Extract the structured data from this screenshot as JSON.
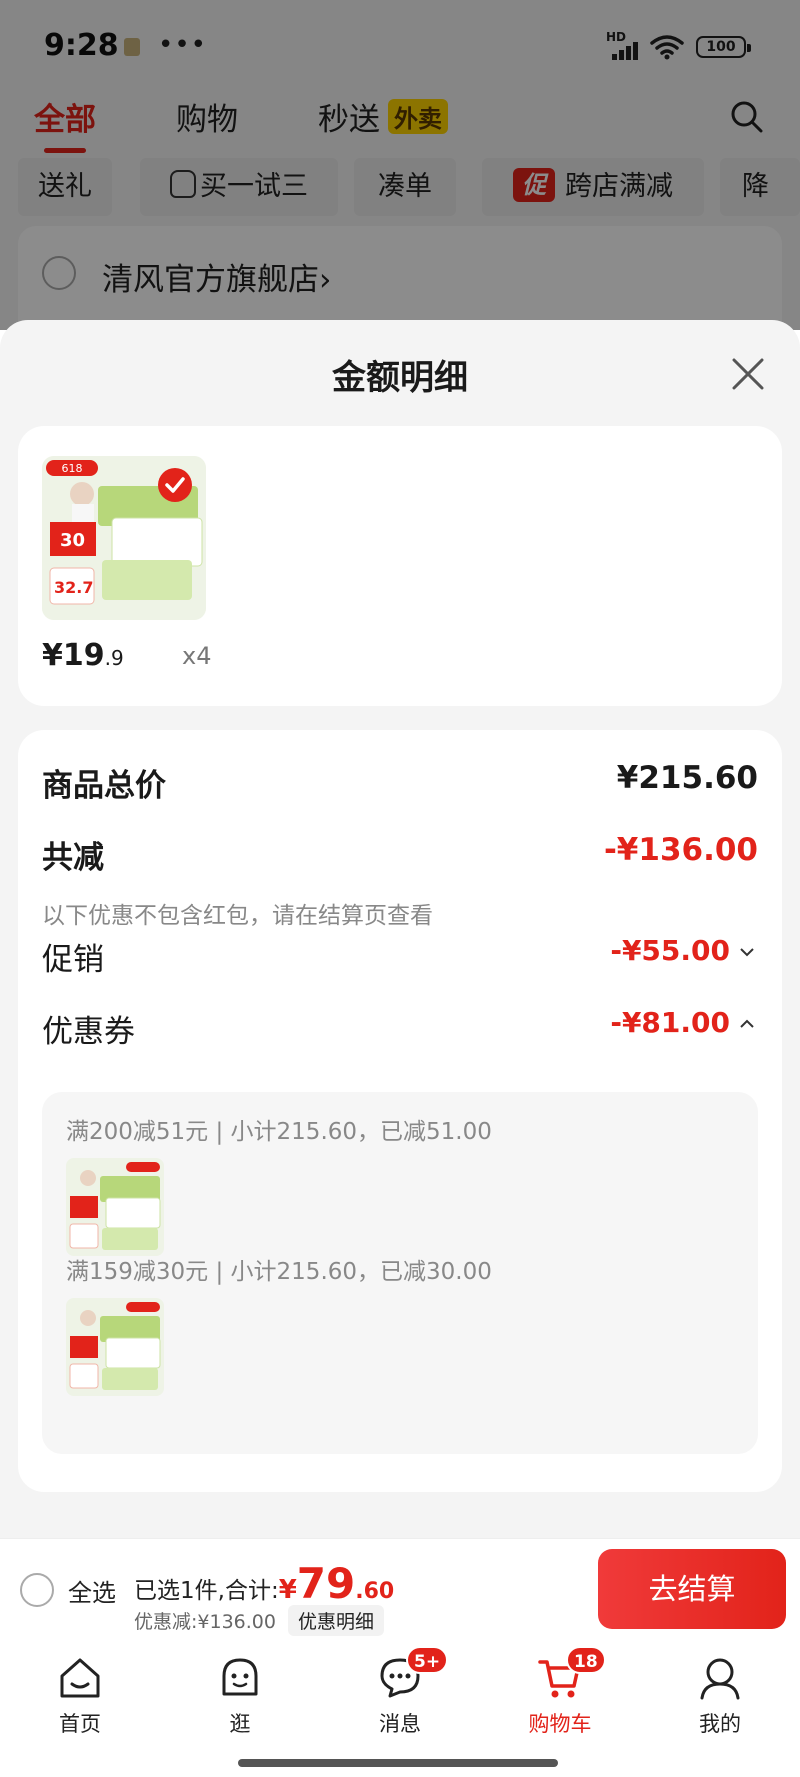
{
  "status_bar": {
    "time": "9:28",
    "dots": "•••",
    "hd": "HD",
    "battery": "100"
  },
  "top_tabs": [
    {
      "label": "全部",
      "active": true
    },
    {
      "label": "购物",
      "active": false
    },
    {
      "label": "秒送",
      "active": false,
      "badge": "外卖"
    }
  ],
  "chips": {
    "gift": "送礼",
    "try": "买一试三",
    "bundle": "凑单",
    "promo_badge": "促",
    "cross_store": "跨店满减",
    "partial": "降"
  },
  "store": {
    "name": "清风官方旗舰店",
    "arrow": "›"
  },
  "sheet": {
    "title": "金额明细",
    "product": {
      "price_main": "¥19",
      "price_dec": ".9",
      "qty": "x4",
      "promo_tag": "618",
      "promo_price": "32.7"
    },
    "total_label": "商品总价",
    "total_value": "¥215.60",
    "reduce_label": "共减",
    "reduce_value": "-¥136.00",
    "reduce_note": "以下优惠不包含红包，请在结算页查看",
    "promo_label": "促销",
    "promo_value": "-¥55.00",
    "coupon_label": "优惠券",
    "coupon_value": "-¥81.00",
    "coupons": [
      {
        "text": "满200减51元 | 小计215.60，已减51.00"
      },
      {
        "text": "满159减30元 | 小计215.60，已减30.00"
      }
    ]
  },
  "checkout": {
    "select_all": "全选",
    "selected_text": "已选1件,合计:",
    "yen": "¥",
    "amount_int": "79",
    "amount_dec": ".60",
    "discount_text": "优惠减:¥136.00",
    "detail_button": "优惠明细",
    "checkout_button": "去结算"
  },
  "nav": [
    {
      "label": "首页",
      "icon": "home-icon"
    },
    {
      "label": "逛",
      "icon": "browse-icon"
    },
    {
      "label": "消息",
      "icon": "message-icon",
      "badge": "5+"
    },
    {
      "label": "购物车",
      "icon": "cart-icon",
      "badge": "18",
      "active": true
    },
    {
      "label": "我的",
      "icon": "profile-icon"
    }
  ],
  "colors": {
    "accent": "#e2231a",
    "overlay": "rgba(0,0,0,0.45)"
  }
}
